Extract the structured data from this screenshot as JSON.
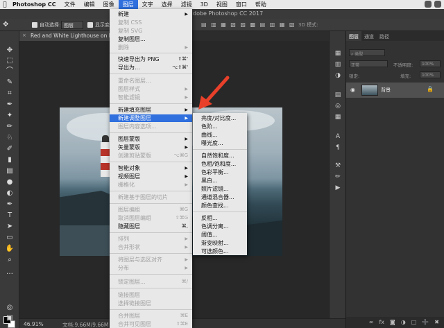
{
  "mac_menubar": {
    "app_name": "Photoshop CC",
    "items": [
      "文件",
      "编辑",
      "图像",
      "图层",
      "文字",
      "选择",
      "滤镜",
      "3D",
      "视图",
      "窗口",
      "帮助"
    ],
    "active": "图层"
  },
  "window_title": "dobe Photoshop CC 2017",
  "options_bar": {
    "auto_select_label": "自动选择:",
    "auto_select_value": "图层",
    "show_transform_label": "显示变",
    "mode_3d_label": "3D 模式:"
  },
  "document_tab": {
    "title": "Red and White Lighthouse on La"
  },
  "status_bar": {
    "zoom": "46.91%",
    "doc_size": "文档:9.66M/9.66M"
  },
  "layers_panel": {
    "tabs": [
      "图层",
      "通道",
      "路径"
    ],
    "filter_label": "类型",
    "blend_mode": "正常",
    "opacity_label": "不透明度:",
    "opacity_value": "100%",
    "lock_label": "锁定:",
    "fill_label": "填充:",
    "fill_value": "100%",
    "layer": {
      "name": "背景"
    },
    "bottom_icons": [
      "link-icon",
      "fx-icon",
      "mask-icon",
      "adjustment-icon",
      "folder-icon",
      "new-layer-icon",
      "trash-icon"
    ]
  },
  "layer_menu": {
    "items": [
      {
        "label": "新建",
        "disabled": false,
        "submenu": true
      },
      {
        "label": "复制 CSS",
        "disabled": true
      },
      {
        "label": "复制 SVG",
        "disabled": true
      },
      {
        "label": "复制图层...",
        "disabled": false
      },
      {
        "label": "删除",
        "disabled": true,
        "submenu": true
      },
      {
        "label": "快速导出为 PNG",
        "disabled": false,
        "shortcut": "⇧⌘'"
      },
      {
        "label": "导出为...",
        "disabled": false,
        "shortcut": "⌥⇧⌘'"
      },
      {
        "label": "重命名图层...",
        "disabled": true
      },
      {
        "label": "图层样式",
        "disabled": true,
        "submenu": true
      },
      {
        "label": "智能滤镜",
        "disabled": true,
        "submenu": true
      },
      {
        "label": "新建填充图层",
        "disabled": false,
        "submenu": true
      },
      {
        "label": "新建调整图层",
        "disabled": false,
        "submenu": true,
        "highlighted": true
      },
      {
        "label": "图层内容选项...",
        "disabled": true
      },
      {
        "label": "图层蒙版",
        "disabled": false,
        "submenu": true
      },
      {
        "label": "矢量蒙版",
        "disabled": false,
        "submenu": true
      },
      {
        "label": "创建剪贴蒙版",
        "disabled": true,
        "shortcut": "⌥⌘G"
      },
      {
        "label": "智能对象",
        "disabled": false,
        "submenu": true
      },
      {
        "label": "视频图层",
        "disabled": false,
        "submenu": true
      },
      {
        "label": "栅格化",
        "disabled": true,
        "submenu": true
      },
      {
        "label": "新建基于图层的切片",
        "disabled": true
      },
      {
        "label": "图层编组",
        "disabled": true,
        "shortcut": "⌘G"
      },
      {
        "label": "取消图层编组",
        "disabled": true,
        "shortcut": "⇧⌘G"
      },
      {
        "label": "隐藏图层",
        "disabled": false,
        "shortcut": "⌘,"
      },
      {
        "label": "排列",
        "disabled": true,
        "submenu": true
      },
      {
        "label": "合并形状",
        "disabled": true,
        "submenu": true
      },
      {
        "label": "将图层与选区对齐",
        "disabled": true,
        "submenu": true
      },
      {
        "label": "分布",
        "disabled": true,
        "submenu": true
      },
      {
        "label": "锁定图层...",
        "disabled": true,
        "shortcut": "⌘/"
      },
      {
        "label": "链接图层",
        "disabled": true
      },
      {
        "label": "选择链接图层",
        "disabled": true
      },
      {
        "label": "合并图层",
        "disabled": true,
        "shortcut": "⌘E"
      },
      {
        "label": "合并可见图层",
        "disabled": true,
        "shortcut": "⇧⌘E"
      }
    ]
  },
  "adjustment_submenu": {
    "items": [
      "亮度/对比度...",
      "色阶...",
      "曲线...",
      "曝光度...",
      "自然饱和度...",
      "色相/饱和度...",
      "色彩平衡...",
      "黑白...",
      "照片滤镜...",
      "通道混合器...",
      "颜色查找...",
      "反相...",
      "色调分离...",
      "阈值...",
      "渐变映射...",
      "可选颜色..."
    ]
  },
  "colors": {
    "accent": "#2f6fde",
    "arrow": "#e8402a"
  }
}
